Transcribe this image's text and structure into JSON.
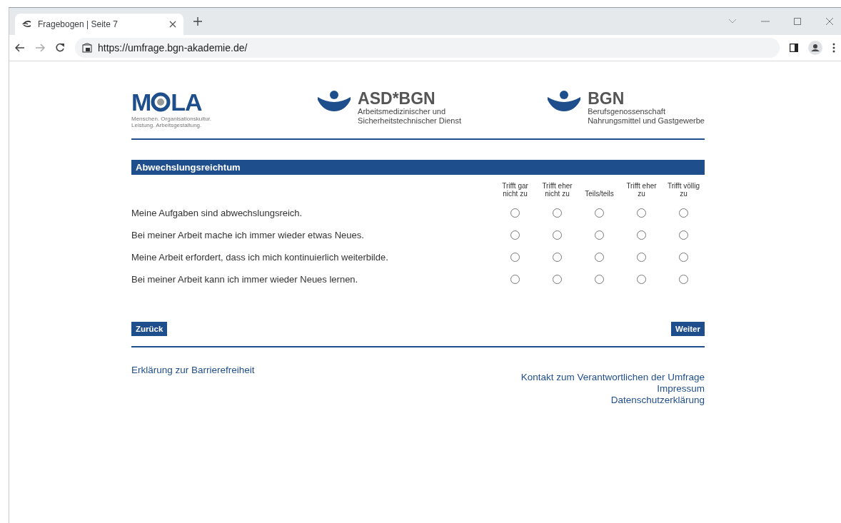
{
  "browser": {
    "tab_title": "Fragebogen | Seite 7",
    "url": "https://umfrage.bgn-akademie.de/"
  },
  "logos": [
    {
      "kind": "mola",
      "parts": [
        "M",
        "LA"
      ],
      "subtitle": "Menschen. Organisationskultur. Leistung. Arbeitsgestaltung."
    },
    {
      "kind": "brand",
      "title": "ASD*BGN",
      "lines": [
        "Arbeitsmedizinischer und",
        "Sicherheitstechnischer Dienst"
      ]
    },
    {
      "kind": "brand",
      "title": "BGN",
      "lines": [
        "Berufsgenossenschaft",
        "Nahrungsmittel und Gastgewerbe"
      ]
    }
  ],
  "section": {
    "title": "Abwechslungsreichtum"
  },
  "scale": [
    "Trifft gar nicht zu",
    "Trifft eher nicht zu",
    "Teils/teils",
    "Trifft eher zu",
    "Trifft völlig zu"
  ],
  "questions": [
    {
      "text": "Meine Aufgaben sind abwechslungsreich.",
      "options": [
        {
          "selected": false
        },
        {
          "selected": false
        },
        {
          "selected": false
        },
        {
          "selected": false
        },
        {
          "selected": false
        }
      ]
    },
    {
      "text": "Bei meiner Arbeit mache ich immer wieder etwas Neues.",
      "options": [
        {
          "selected": false
        },
        {
          "selected": false
        },
        {
          "selected": false
        },
        {
          "selected": false
        },
        {
          "selected": false
        }
      ]
    },
    {
      "text": "Meine Arbeit erfordert, dass ich mich kontinuierlich weiterbilde.",
      "options": [
        {
          "selected": false
        },
        {
          "selected": false
        },
        {
          "selected": false
        },
        {
          "selected": false
        },
        {
          "selected": false
        }
      ]
    },
    {
      "text": "Bei meiner Arbeit kann ich immer wieder Neues lernen.",
      "options": [
        {
          "selected": false
        },
        {
          "selected": false
        },
        {
          "selected": false
        },
        {
          "selected": false
        },
        {
          "selected": false
        }
      ]
    }
  ],
  "buttons": {
    "back": "Zurück",
    "next": "Weiter"
  },
  "footer": {
    "left": [
      "Erklärung zur Barrierefreiheit"
    ],
    "right": [
      "Kontakt zum Verantwortlichen der Umfrage",
      "Impressum",
      "Datenschutzerklärung"
    ]
  }
}
